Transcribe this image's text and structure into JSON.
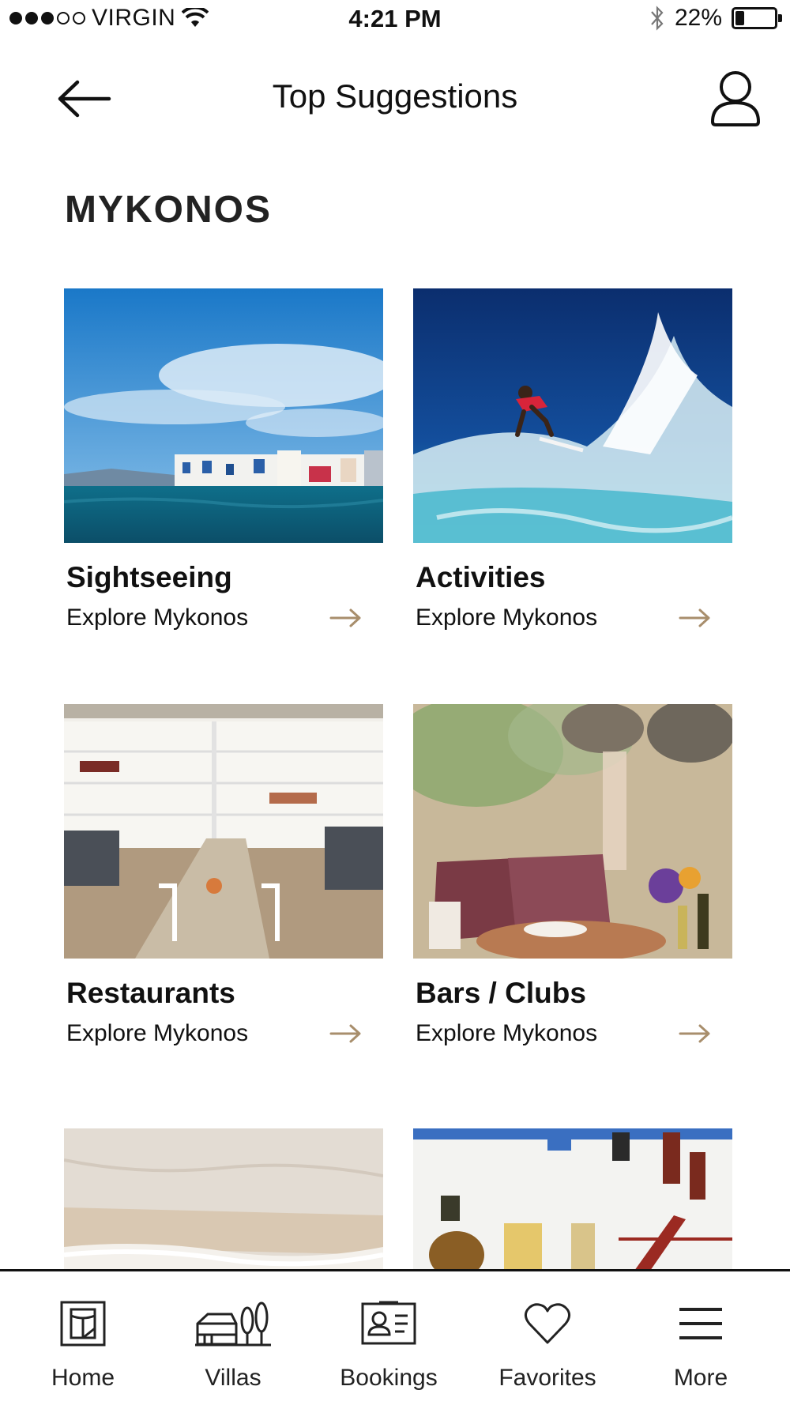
{
  "status_bar": {
    "carrier": "VIRGIN",
    "time": "4:21 PM",
    "battery_percent_text": "22%",
    "battery_level": 0.22
  },
  "nav": {
    "title": "Top Suggestions",
    "back_icon": "arrow-left-icon",
    "profile_icon": "user-icon"
  },
  "section": {
    "title": "MYKONOS"
  },
  "cards": [
    {
      "title": "Sightseeing",
      "subtitle": "Explore Mykonos",
      "image": "mykonos-waterfront-photo"
    },
    {
      "title": "Activities",
      "subtitle": "Explore Mykonos",
      "image": "surfer-wave-photo"
    },
    {
      "title": "Restaurants",
      "subtitle": "Explore Mykonos",
      "image": "white-restaurant-interior-photo"
    },
    {
      "title": "Bars / Clubs",
      "subtitle": "Explore Mykonos",
      "image": "outdoor-bar-table-photo"
    },
    {
      "title": "",
      "subtitle": "",
      "image": "sandy-beach-photo"
    },
    {
      "title": "",
      "subtitle": "",
      "image": "white-shopfront-street-photo"
    }
  ],
  "tabbar": {
    "items": [
      {
        "label": "Home",
        "icon": "home-icon"
      },
      {
        "label": "Villas",
        "icon": "villa-icon"
      },
      {
        "label": "Bookings",
        "icon": "bookings-card-icon"
      },
      {
        "label": "Favorites",
        "icon": "heart-icon"
      },
      {
        "label": "More",
        "icon": "menu-icon"
      }
    ]
  },
  "colors": {
    "accent_arrow": "#a88e6c",
    "text": "#111111",
    "background": "#ffffff"
  }
}
